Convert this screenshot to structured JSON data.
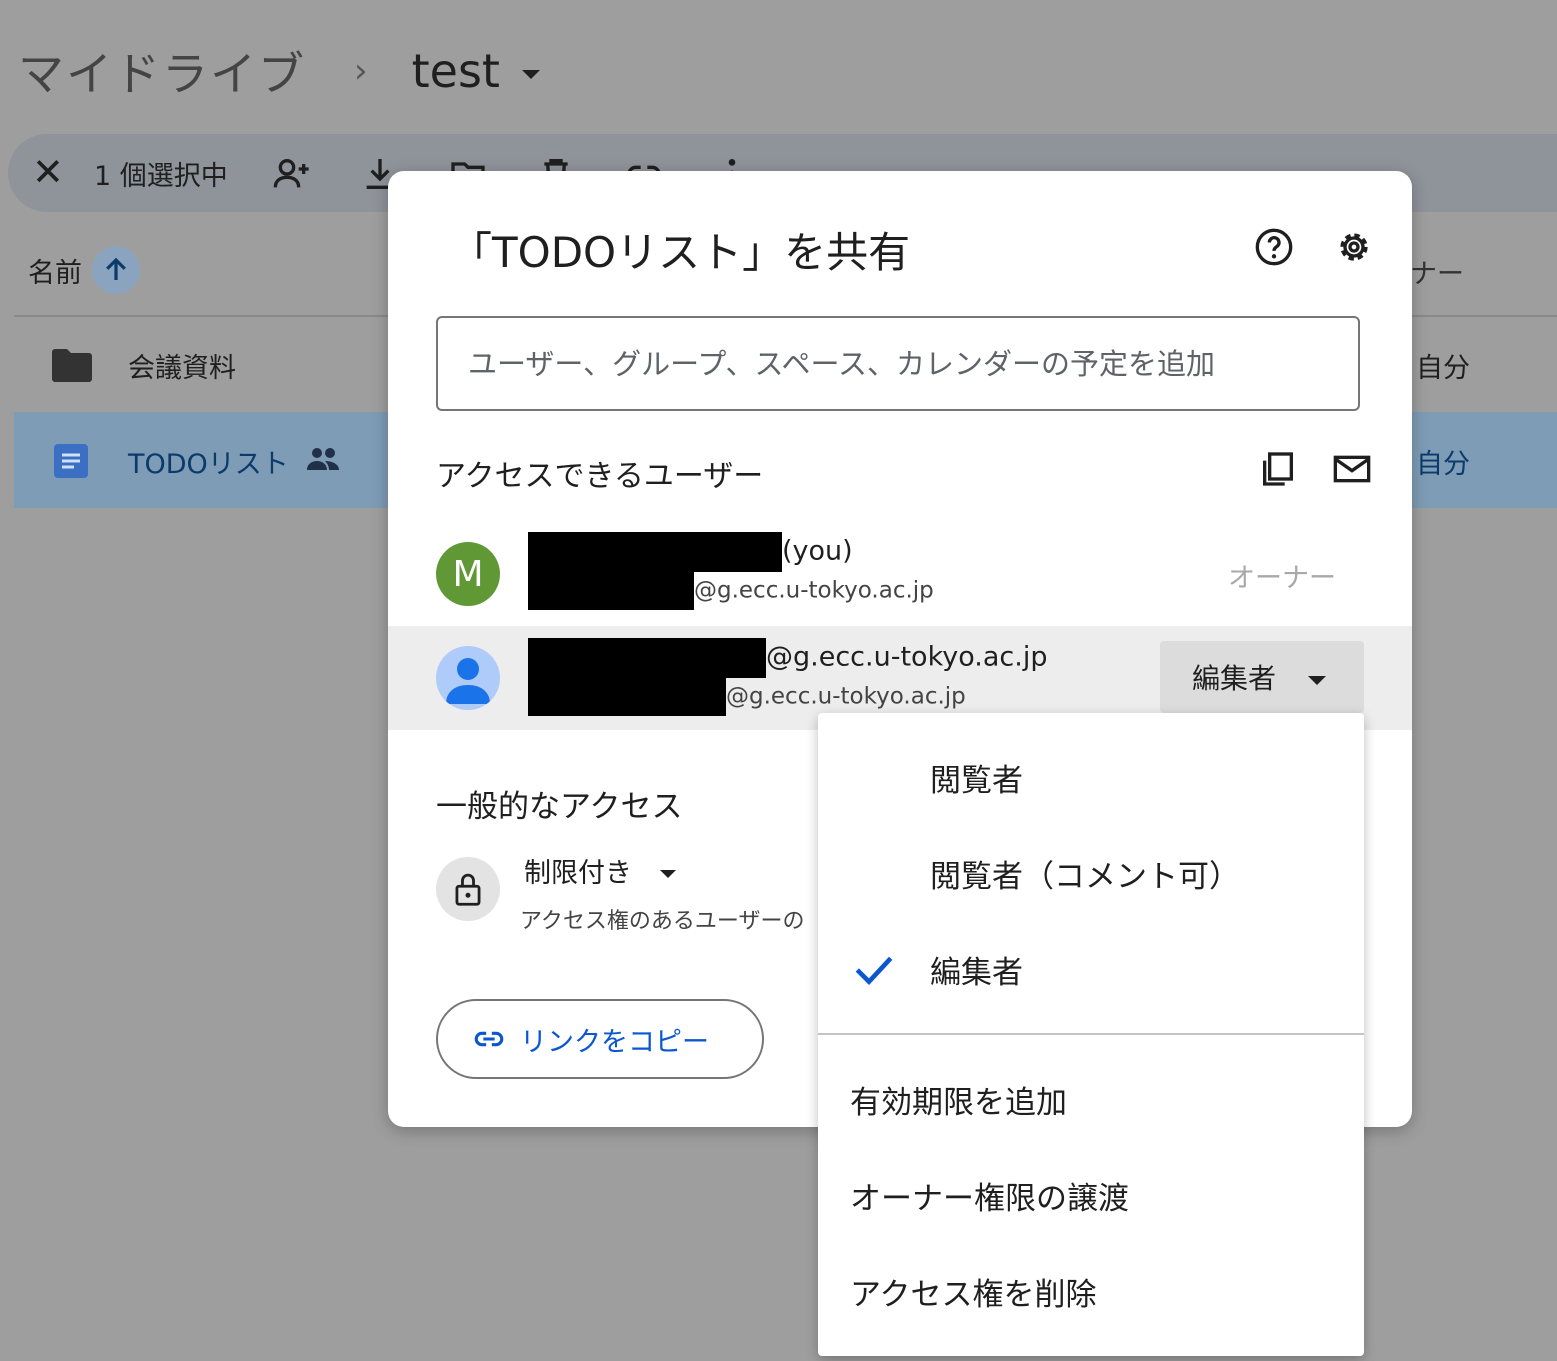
{
  "breadcrumb": {
    "root": "マイドライブ",
    "current": "test"
  },
  "selection": {
    "count_label": "1 個選択中"
  },
  "file_list": {
    "name_header": "名前",
    "owner_header": "ナー",
    "rows": [
      {
        "name": "会議資料",
        "owner": "自分"
      },
      {
        "name": "TODOリスト",
        "owner": "自分"
      }
    ]
  },
  "share_dialog": {
    "title": "「TODOリスト」を共有",
    "add_placeholder": "ユーザー、グループ、スペース、カレンダーの予定を追加",
    "access_title": "アクセスできるユーザー",
    "users": [
      {
        "avatar_letter": "M",
        "name_suffix": "(you)",
        "email_suffix": "@g.ecc.u-tokyo.ac.jp",
        "role": "オーナー"
      },
      {
        "name_suffix": "@g.ecc.u-tokyo.ac.jp",
        "email_suffix": "@g.ecc.u-tokyo.ac.jp",
        "role": "編集者"
      }
    ],
    "general_title": "一般的なアクセス",
    "restriction": "制限付き",
    "restriction_desc": "アクセス権のあるユーザーの",
    "copy_link": "リンクをコピー"
  },
  "role_menu": {
    "items": [
      "閲覧者",
      "閲覧者（コメント可）",
      "編集者"
    ],
    "selected": "編集者",
    "actions": [
      "有効期限を追加",
      "オーナー権限の譲渡",
      "アクセス権を削除"
    ]
  },
  "colors": {
    "accent": "#0b57d0",
    "owner_avatar": "#5f9834",
    "selected_row": "#7e9cb6"
  }
}
